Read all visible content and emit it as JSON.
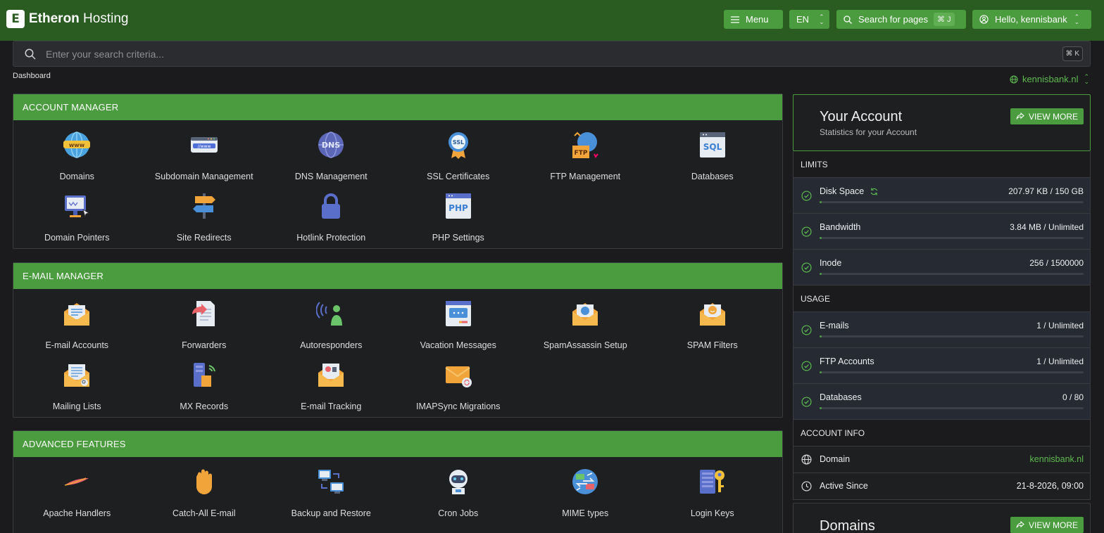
{
  "brand": {
    "logo_letter": "E",
    "name_bold": "Etheron",
    "name_rest": " Hosting"
  },
  "topbar": {
    "menu_label": "Menu",
    "lang": "EN",
    "search_pages_label": "Search for pages",
    "search_pages_kbd": "⌘ J",
    "user_label": "Hello, kennisbank"
  },
  "search": {
    "placeholder": "Enter your search criteria...",
    "kbd": "⌘ K"
  },
  "breadcrumb": "Dashboard",
  "domain_selector": "kennisbank.nl",
  "sections": {
    "account": {
      "title": "ACCOUNT MANAGER",
      "items": [
        "Domains",
        "Subdomain Management",
        "DNS Management",
        "SSL Certificates",
        "FTP Management",
        "Databases",
        "Domain Pointers",
        "Site Redirects",
        "Hotlink Protection",
        "PHP Settings"
      ]
    },
    "email": {
      "title": "E-MAIL MANAGER",
      "items": [
        "E-mail Accounts",
        "Forwarders",
        "Autoresponders",
        "Vacation Messages",
        "SpamAssassin Setup",
        "SPAM Filters",
        "Mailing Lists",
        "MX Records",
        "E-mail Tracking",
        "IMAPSync Migrations"
      ]
    },
    "advanced": {
      "title": "ADVANCED FEATURES",
      "items": [
        "Apache Handlers",
        "Catch-All E-mail",
        "Backup and Restore",
        "Cron Jobs",
        "MIME types",
        "Login Keys"
      ]
    }
  },
  "icons": {
    "account": [
      "globe-www-icon",
      "browser-www-icon",
      "dns-globe-icon",
      "ssl-badge-icon",
      "ftp-folder-icon",
      "sql-database-icon",
      "monitor-pointer-icon",
      "signpost-icon",
      "padlock-icon",
      "php-file-icon"
    ],
    "email": [
      "envelope-open-icon",
      "forward-mail-icon",
      "autoresponder-person-icon",
      "chat-window-icon",
      "envelope-shield-icon",
      "envelope-smiley-icon",
      "mailing-list-icon",
      "server-signal-icon",
      "mail-tracking-icon",
      "envelope-sync-icon"
    ],
    "advanced": [
      "feather-icon",
      "hand-icon",
      "backup-computers-icon",
      "robot-icon",
      "mime-globe-icon",
      "server-key-icon"
    ]
  },
  "account_card": {
    "title": "Your Account",
    "subtitle": "Statistics for your Account",
    "view_more": "VIEW MORE",
    "limits_title": "LIMITS",
    "limits": [
      {
        "name": "Disk Space",
        "value": "207.97 KB / 150 GB",
        "fill": 0.001,
        "refresh": true
      },
      {
        "name": "Bandwidth",
        "value": "3.84 MB / Unlimited",
        "fill": 0.001
      },
      {
        "name": "Inode",
        "value": "256 / 1500000",
        "fill": 0.001
      }
    ],
    "usage_title": "USAGE",
    "usage": [
      {
        "name": "E-mails",
        "value": "1 / Unlimited",
        "fill": 0.001
      },
      {
        "name": "FTP Accounts",
        "value": "1 / Unlimited",
        "fill": 0.001
      },
      {
        "name": "Databases",
        "value": "0 / 80",
        "fill": 0.0
      }
    ],
    "info_title": "ACCOUNT INFO",
    "info": [
      {
        "name": "Domain",
        "value": "kennisbank.nl"
      },
      {
        "name": "Active Since",
        "value": "21-8-2026, 09:00"
      }
    ]
  },
  "domains_card": {
    "title": "Domains",
    "view_more": "VIEW MORE"
  },
  "colors": {
    "topbar": "#2a5c22",
    "accent": "#4a9c3e",
    "link": "#5dbb4f",
    "bg": "#1b1b1d"
  }
}
